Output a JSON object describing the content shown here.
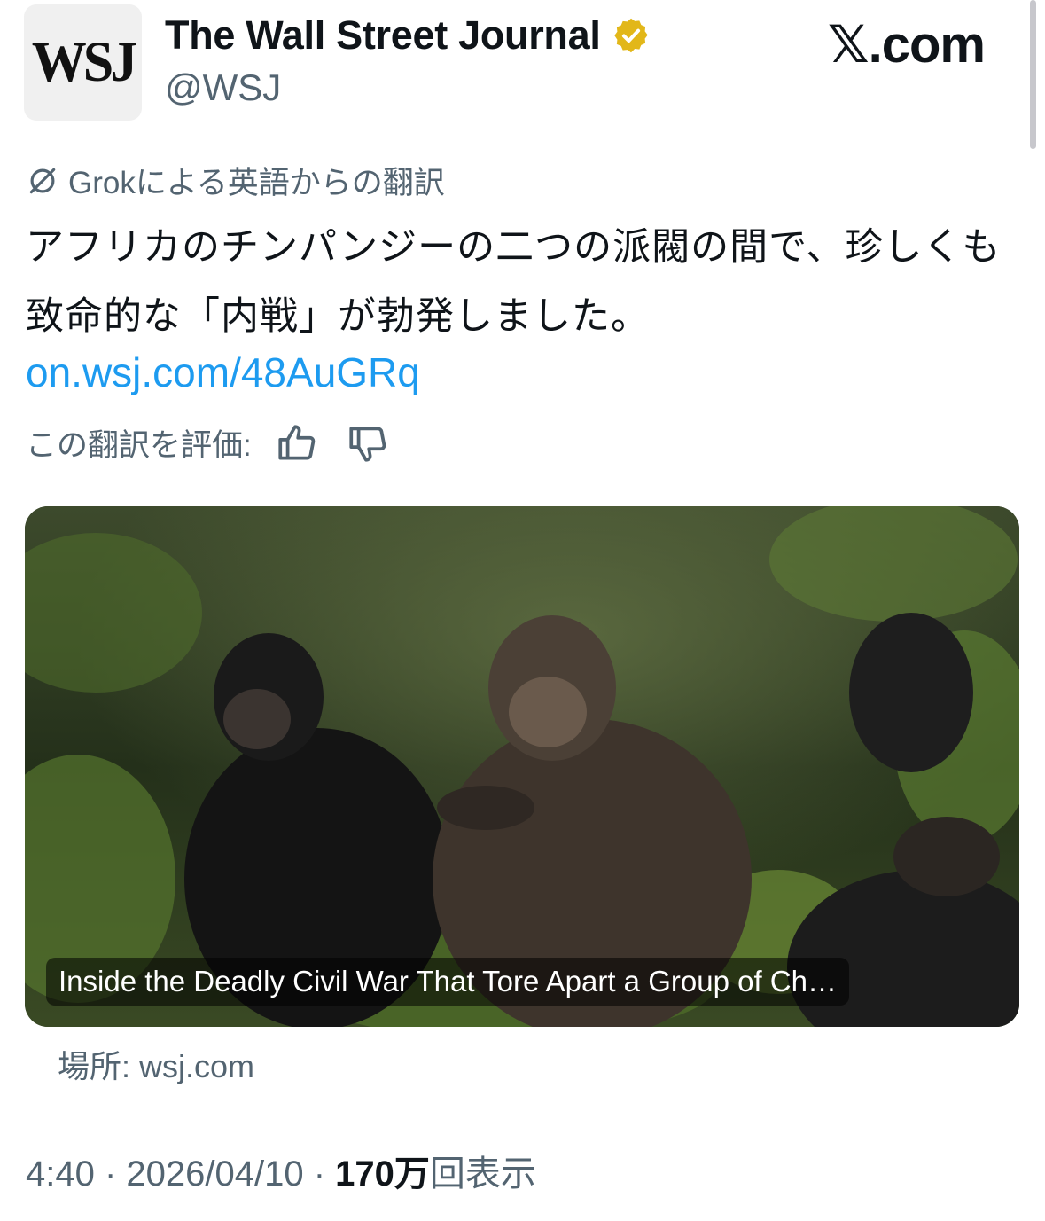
{
  "header": {
    "avatar_text": "WSJ",
    "display_name": "The Wall Street Journal",
    "handle": "@WSJ",
    "site_label": "𝕏.com",
    "verified_icon": "gold-verified-badge-icon"
  },
  "tweet": {
    "translation_label": "Grokによる英語からの翻訳",
    "text": "アフリカのチンパンジーの二つの派閥の間で、珍しくも致命的な「内戦」が勃発しました。",
    "link": "on.wsj.com/48AuGRq",
    "rate_label": "この翻訳を評価:"
  },
  "card": {
    "title": "Inside the Deadly Civil War That Tore Apart a Group of Ch…",
    "source": "場所: wsj.com"
  },
  "meta": {
    "time": "4:40",
    "sep1": " · ",
    "date": "2026/04/10",
    "sep2": " · ",
    "views_count": "170万",
    "views_label": "回表示"
  },
  "colors": {
    "link": "#1d9bf0",
    "secondary_text": "#536471",
    "verified_gold": "#e2b719"
  }
}
